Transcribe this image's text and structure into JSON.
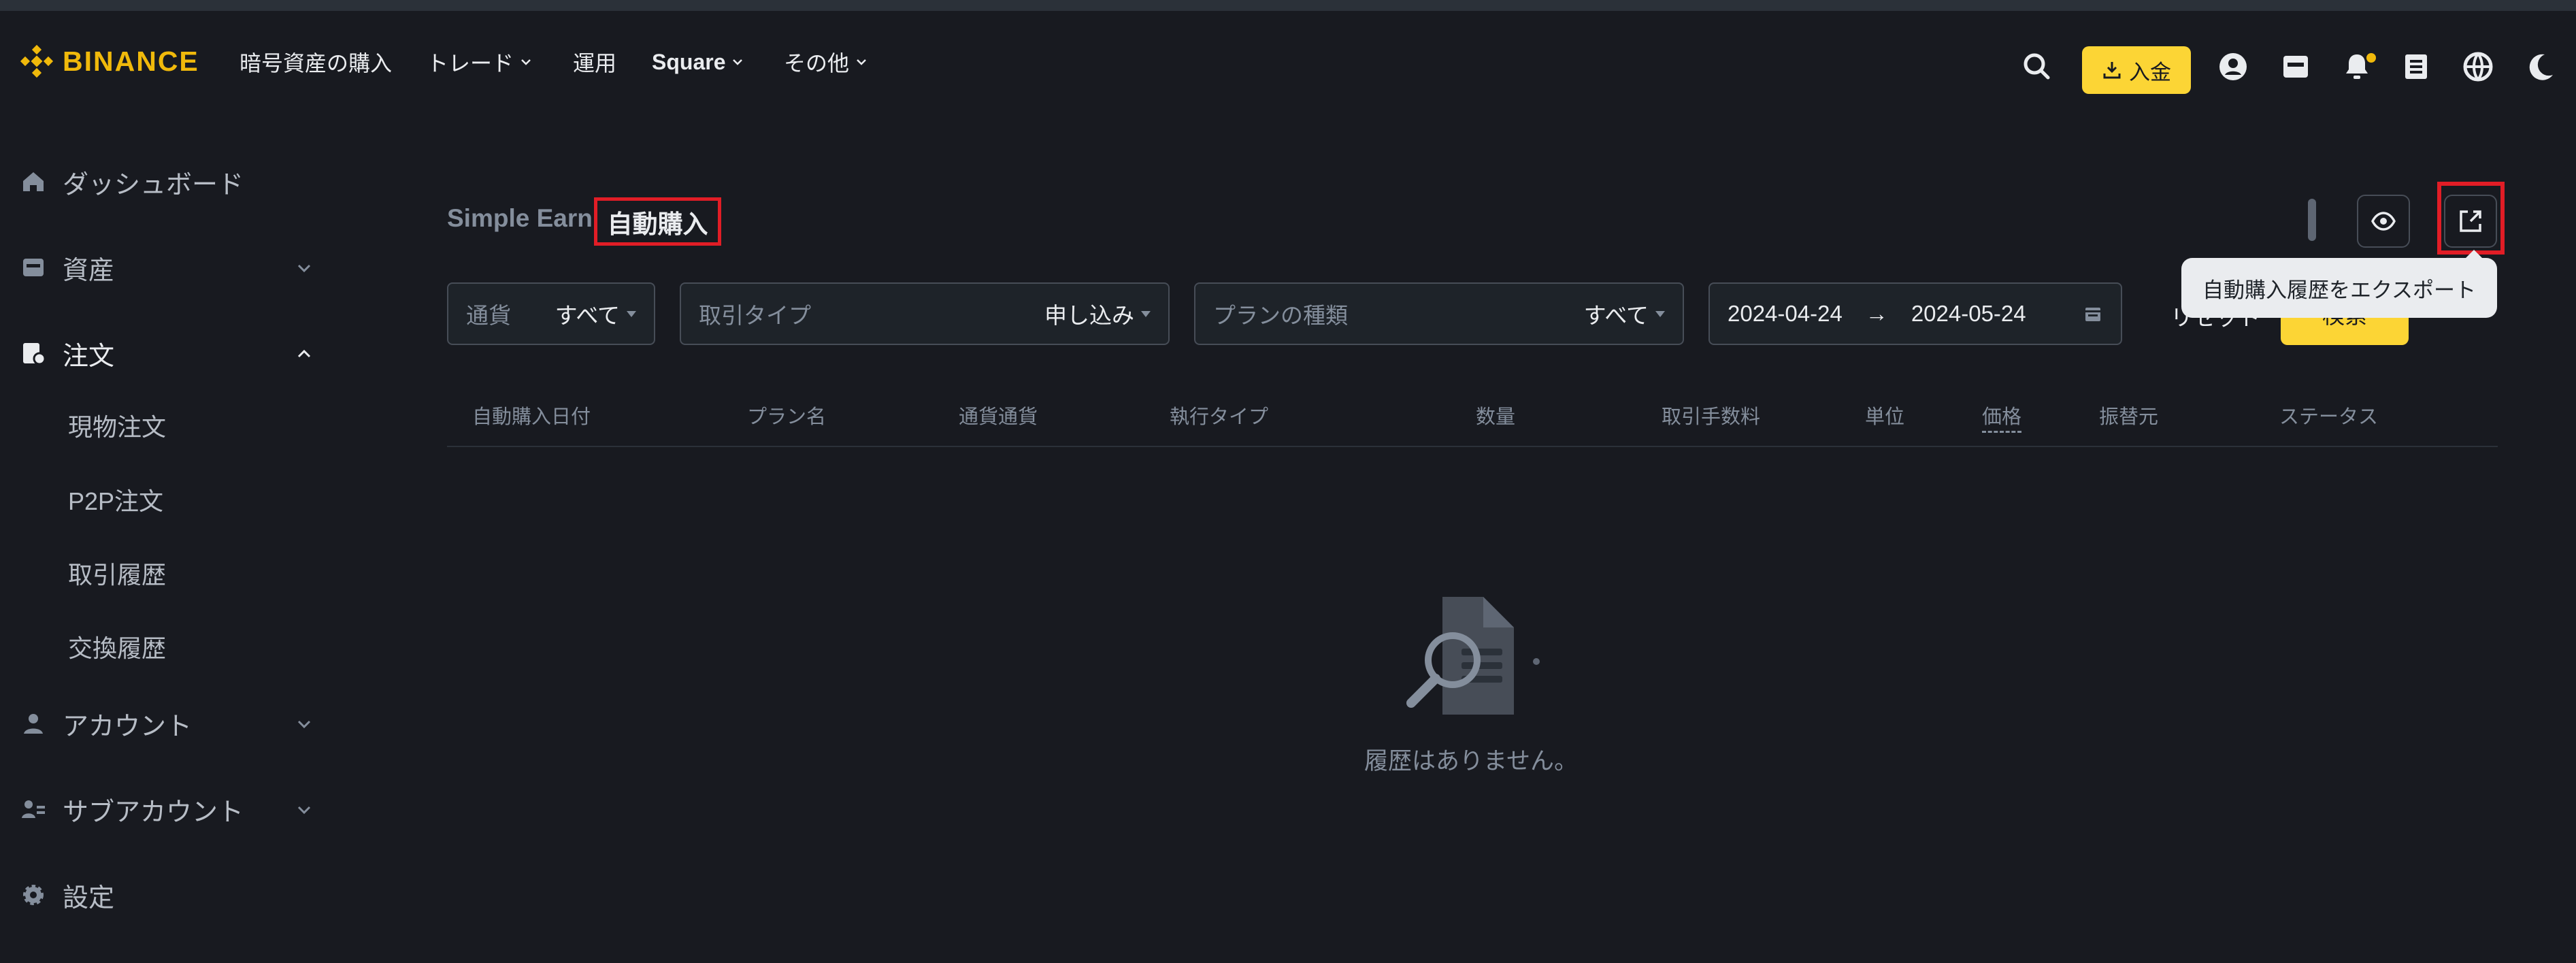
{
  "colors": {
    "background": "#181a20",
    "brand_yellow": "#f0b90b",
    "button_yellow": "#fcd535",
    "highlight_red": "#e11d26",
    "muted_text": "#848e9c"
  },
  "header": {
    "logo_text": "BINANCE",
    "nav": [
      {
        "label": "暗号資産の購入"
      },
      {
        "label": "トレード"
      },
      {
        "label": "運用"
      },
      {
        "label": "Square"
      },
      {
        "label": "その他"
      }
    ],
    "deposit_label": "入金",
    "icons": [
      "search-icon",
      "download-icon",
      "user-icon",
      "wallet-icon",
      "bell-icon",
      "orders-icon",
      "globe-icon",
      "moon-icon"
    ]
  },
  "sidebar": {
    "items": [
      {
        "label": "ダッシュボード",
        "icon": "home-icon"
      },
      {
        "label": "資産",
        "icon": "wallet-icon"
      },
      {
        "label": "注文",
        "icon": "orders-icon"
      },
      {
        "label": "アカウント",
        "icon": "user-icon"
      },
      {
        "label": "サブアカウント",
        "icon": "sub-account-icon"
      },
      {
        "label": "設定",
        "icon": "gear-icon"
      }
    ],
    "sub_items": [
      {
        "label": "現物注文"
      },
      {
        "label": "P2P注文"
      },
      {
        "label": "取引履歴"
      },
      {
        "label": "交換履歴"
      }
    ]
  },
  "main": {
    "breadcrumb_parent": "Simple Earn",
    "breadcrumb_current": "自動購入",
    "tooltip": "自動購入履歴をエクスポート",
    "filters": {
      "currency_label": "通貨",
      "currency_value": "すべて",
      "trade_type_label": "取引タイプ",
      "trade_type_value": "申し込み",
      "plan_type_label": "プランの種類",
      "plan_type_value": "すべて",
      "date_start": "2024-04-24",
      "date_arrow": "→",
      "date_end": "2024-05-24"
    },
    "reset_label": "リセット",
    "search_label": "検索",
    "columns": [
      "自動購入日付",
      "プラン名",
      "通貨通貨",
      "執行タイプ",
      "数量",
      "取引手数料",
      "単位",
      "価格",
      "振替元",
      "ステータス"
    ],
    "empty_text": "履歴はありません。"
  }
}
